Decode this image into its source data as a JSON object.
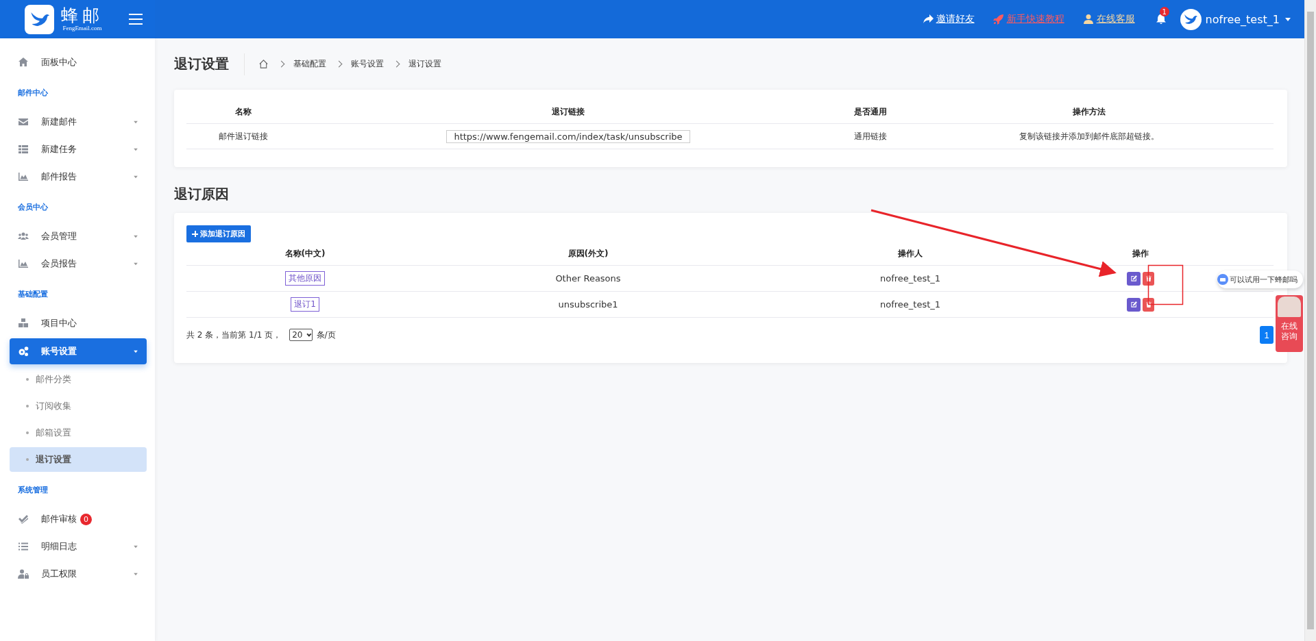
{
  "header": {
    "logo": {
      "name": "蜂邮",
      "sub": "FengEmail.com"
    },
    "links": [
      {
        "kind": "share",
        "label": "邀请好友"
      },
      {
        "kind": "rocket",
        "label": "新手快速教程"
      },
      {
        "kind": "user",
        "label": "在线客服"
      }
    ],
    "notification_count": "1",
    "user": "nofree_test_1"
  },
  "sidebar": {
    "items": [
      {
        "kind": "item",
        "label": "面板中心",
        "caret": false,
        "selected": false
      },
      {
        "kind": "section",
        "label": "邮件中心"
      },
      {
        "kind": "item",
        "label": "新建邮件",
        "caret": true,
        "selected": false
      },
      {
        "kind": "item",
        "label": "新建任务",
        "caret": true,
        "selected": false
      },
      {
        "kind": "item",
        "label": "邮件报告",
        "caret": true,
        "selected": false
      },
      {
        "kind": "section",
        "label": "会员中心"
      },
      {
        "kind": "item",
        "label": "会员管理",
        "caret": true,
        "selected": false
      },
      {
        "kind": "item",
        "label": "会员报告",
        "caret": true,
        "selected": false
      },
      {
        "kind": "section",
        "label": "基础配置"
      },
      {
        "kind": "item",
        "label": "项目中心",
        "caret": false,
        "selected": false
      },
      {
        "kind": "item",
        "label": "账号设置",
        "caret": true,
        "selected": true
      },
      {
        "kind": "subitem",
        "label": "邮件分类",
        "selected": false
      },
      {
        "kind": "subitem",
        "label": "订阅收集",
        "selected": false
      },
      {
        "kind": "subitem",
        "label": "邮箱设置",
        "selected": false
      },
      {
        "kind": "subitem",
        "label": "退订设置",
        "selected": true
      },
      {
        "kind": "section",
        "label": "系统管理"
      },
      {
        "kind": "item",
        "label": "邮件审核",
        "caret": false,
        "selected": false,
        "badge": "0"
      },
      {
        "kind": "item",
        "label": "明细日志",
        "caret": true,
        "selected": false
      },
      {
        "kind": "item",
        "label": "员工权限",
        "caret": true,
        "selected": false
      }
    ]
  },
  "page": {
    "title": "退订设置",
    "breadcrumb": [
      "基础配置",
      "账号设置",
      "退订设置"
    ]
  },
  "link_table": {
    "columns": [
      "名称",
      "退订链接",
      "是否通用",
      "操作方法"
    ],
    "rows": [
      {
        "name": "邮件退订链接",
        "link": "https://www.fengemail.com/index/task/unsubscribe",
        "scope": "通用链接",
        "method": "复制该链接并添加到邮件底部超链接。"
      }
    ]
  },
  "reasons": {
    "title": "退订原因",
    "add_button": "添加退订原因",
    "columns": [
      "名称(中文)",
      "原因(外文)",
      "操作人",
      "操作"
    ],
    "rows": [
      {
        "name": "其他原因",
        "reason": "Other Reasons",
        "operator": "nofree_test_1"
      },
      {
        "name": "退订1",
        "reason": "unsubscribe1",
        "operator": "nofree_test_1"
      }
    ],
    "pagination": {
      "summary": "共 2 条，当前第 1/1 页，",
      "page_size": "20",
      "unit": "条/页",
      "pages": [
        {
          "label": "1",
          "selected": true
        }
      ]
    }
  },
  "chat": {
    "bubble": "可以试用一下蜂邮吗",
    "button": [
      "在线",
      "咨询"
    ]
  }
}
